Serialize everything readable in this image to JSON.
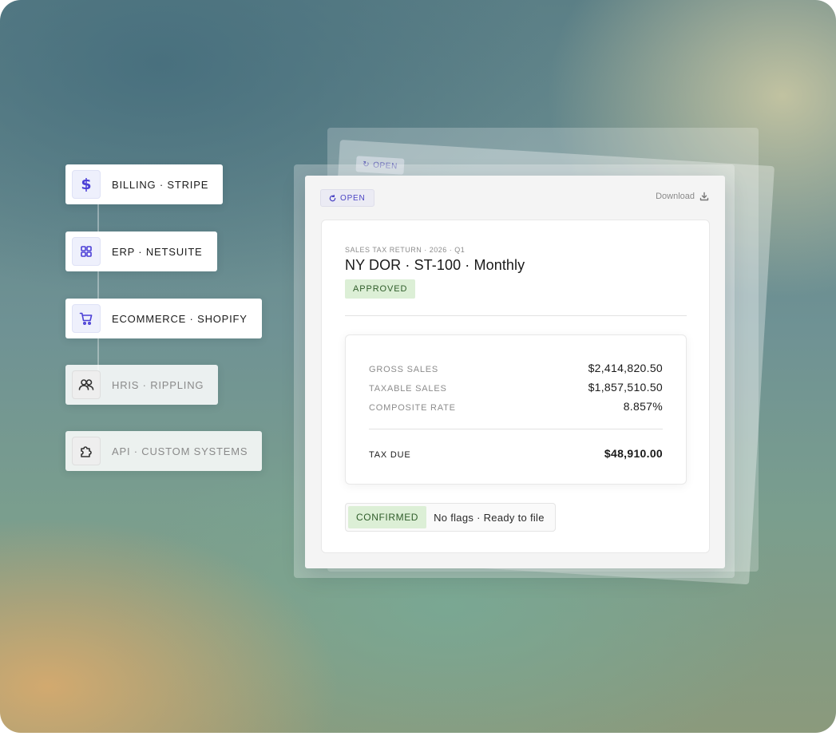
{
  "connectors": [
    {
      "label": "BILLING · STRIPE",
      "icon": "dollar-icon",
      "glyph": "$",
      "active": true
    },
    {
      "label": "ERP · NETSUITE",
      "icon": "grid-icon",
      "active": true
    },
    {
      "label": "ECOMMERCE · SHOPIFY",
      "icon": "cart-icon",
      "active": true
    },
    {
      "label": "HRIS · RIPPLING",
      "icon": "users-icon",
      "active": false
    },
    {
      "label": "API · CUSTOM SYSTEMS",
      "icon": "puzzle-icon",
      "active": false
    }
  ],
  "card": {
    "status_badge": "OPEN",
    "download_label": "Download",
    "eyebrow": "SALES TAX RETURN · 2026 · Q1",
    "title": "NY DOR · ST-100 · Monthly",
    "approval": "APPROVED",
    "figures": {
      "gross_sales_label": "GROSS SALES",
      "gross_sales_value": "$2,414,820.50",
      "taxable_sales_label": "TAXABLE SALES",
      "taxable_sales_value": "$1,857,510.50",
      "composite_rate_label": "COMPOSITE RATE",
      "composite_rate_value": "8.857%",
      "tax_due_label": "TAX DUE",
      "tax_due_value": "$48,910.00"
    },
    "confirmation": "CONFIRMED",
    "confirmation_note": "No flags · Ready to file"
  },
  "colors": {
    "accent": "#4b3fd6",
    "success_bg": "#dcefd6",
    "success_text": "#2f5d2a"
  }
}
